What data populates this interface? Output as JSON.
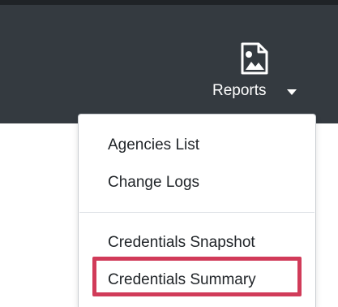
{
  "navbar": {
    "reports": {
      "label": "Reports",
      "icon": "image-file-icon",
      "caret_icon": "caret-down-icon"
    }
  },
  "dropdown": {
    "items": [
      {
        "label": "Agencies List"
      },
      {
        "label": "Change Logs"
      },
      {
        "label": "Credentials Snapshot"
      },
      {
        "label": "Credentials Summary"
      }
    ],
    "highlighted_item": "Credentials Summary"
  },
  "colors": {
    "navbar_bg": "#343a40",
    "menu_text": "#212529",
    "highlight_border": "#d13b59",
    "white": "#ffffff"
  }
}
